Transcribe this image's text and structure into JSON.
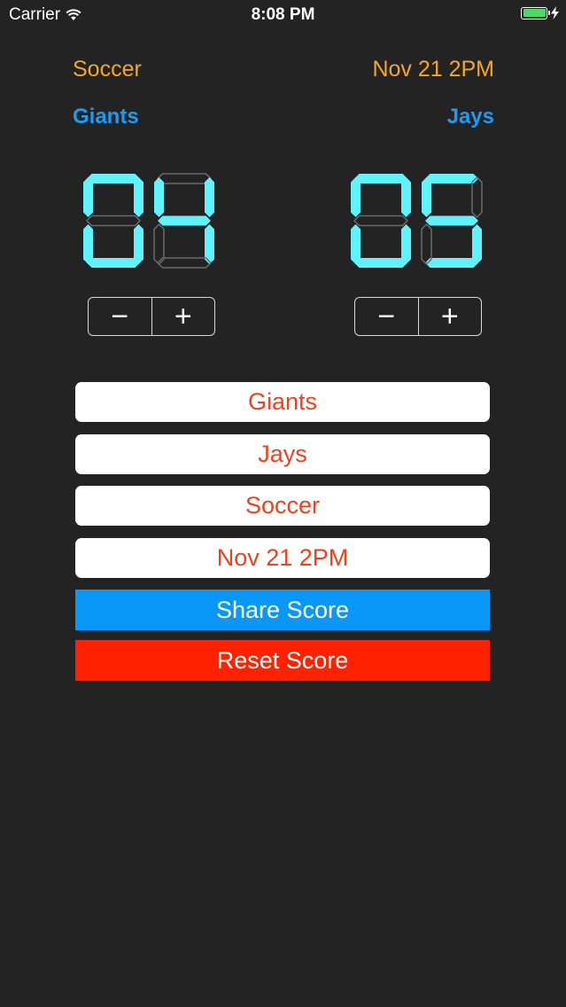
{
  "status": {
    "carrier": "Carrier",
    "time": "8:08 PM",
    "battery_level": 1.0,
    "charging_icon": "bolt-icon",
    "wifi_icon": "wifi-icon"
  },
  "header": {
    "sport": "Soccer",
    "datetime": "Nov 21 2PM"
  },
  "teams": {
    "home": "Giants",
    "away": "Jays"
  },
  "scores": {
    "home": "04",
    "away": "05"
  },
  "colors": {
    "accent_orange": "#f5a623",
    "team_blue": "#1d9bf0",
    "digit_on": "#5ff2ff",
    "field_text": "#f2401c",
    "share": "#0a98f8",
    "reset": "#ff2200"
  },
  "steppers": {
    "minus": "−",
    "plus": "+"
  },
  "fields": {
    "home_team": "Giants",
    "away_team": "Jays",
    "sport": "Soccer",
    "datetime": "Nov 21 2PM"
  },
  "buttons": {
    "share": "Share Score",
    "reset": "Reset Score"
  }
}
